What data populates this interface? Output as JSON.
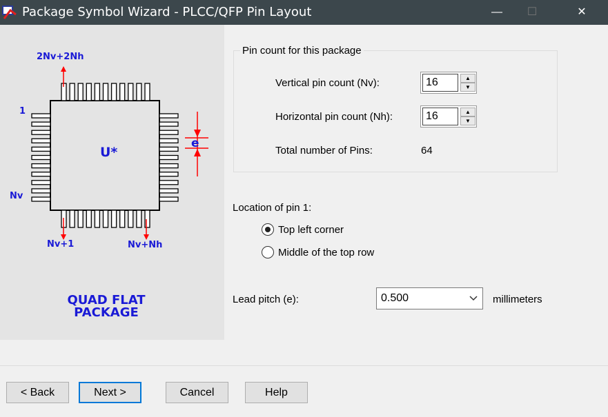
{
  "window": {
    "title": "Package Symbol Wizard - PLCC/QFP Pin Layout",
    "minimize": "—",
    "maximize": "☐",
    "close": "✕"
  },
  "diagram": {
    "label_top": "2Nv+2Nh",
    "label_pin1": "1",
    "label_nv": "Nv",
    "label_nv1": "Nv+1",
    "label_nvnh": "Nv+Nh",
    "designator": "U*",
    "pitch_label": "e",
    "caption_line1": "QUAD FLAT",
    "caption_line2": "PACKAGE",
    "pin_color": "#ff0000",
    "label_color": "#1a1ad6"
  },
  "pin_count": {
    "group_label": "Pin count for this package",
    "vertical_label": "Vertical pin count (Nv):",
    "vertical_value": "16",
    "horizontal_label": "Horizontal pin count (Nh):",
    "horizontal_value": "16",
    "total_label": "Total number of Pins:",
    "total_value": "64"
  },
  "pin1": {
    "label": "Location of pin 1:",
    "options": [
      {
        "label": "Top left corner",
        "selected": true
      },
      {
        "label": "Middle of the top row",
        "selected": false
      }
    ]
  },
  "lead_pitch": {
    "label": "Lead pitch (e):",
    "value": "0.500",
    "unit": "millimeters"
  },
  "buttons": {
    "back": "< Back",
    "next": "Next >",
    "cancel": "Cancel",
    "help": "Help"
  }
}
